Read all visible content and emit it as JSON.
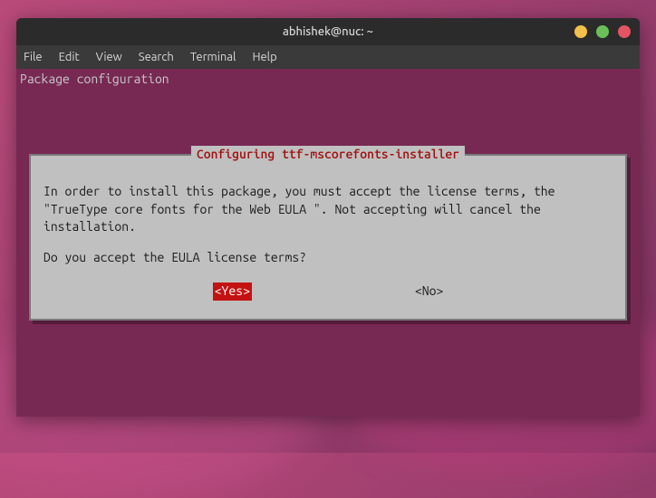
{
  "window": {
    "title": "abhishek@nuc: ~"
  },
  "menubar": {
    "file": "File",
    "edit": "Edit",
    "view": "View",
    "search": "Search",
    "terminal": "Terminal",
    "help": "Help"
  },
  "term": {
    "header": "Package configuration"
  },
  "dialog": {
    "title": "Configuring ttf-mscorefonts-installer",
    "body_line1": "In order to install this package, you must accept the license terms, the \"TrueType core fonts for the Web EULA \". Not accepting will cancel the installation.",
    "body_line2": "Do you accept the EULA license terms?",
    "yes": "<Yes>",
    "no": "<No>"
  }
}
